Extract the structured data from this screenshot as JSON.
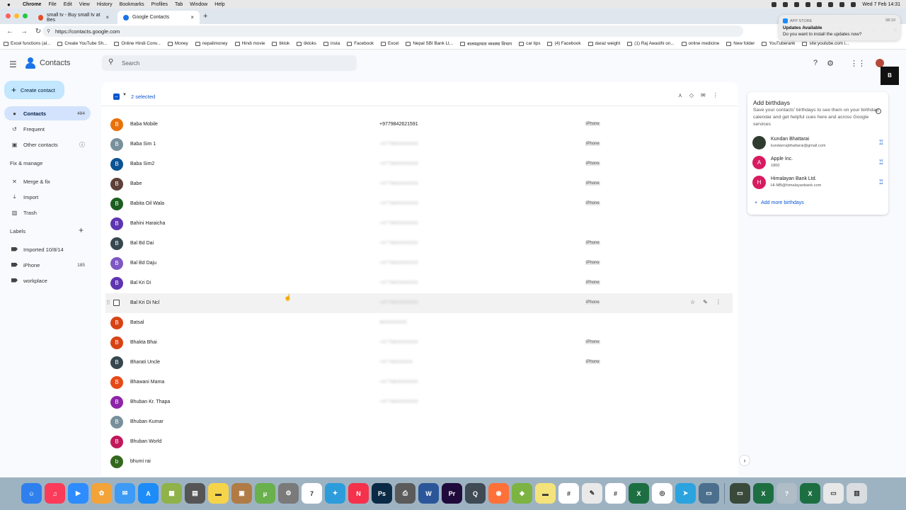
{
  "menubar": {
    "app": "Chrome",
    "items": [
      "File",
      "Edit",
      "View",
      "History",
      "Bookmarks",
      "Profiles",
      "Tab",
      "Window",
      "Help"
    ],
    "clock": "Wed 7 Feb  14:31"
  },
  "tabs": [
    {
      "title": "small tv - Buy small tv at Bes",
      "favicon_color": "#e44d26"
    },
    {
      "title": "Google Contacts",
      "favicon_color": "#1a73e8"
    }
  ],
  "address": {
    "url": "https://contacts.google.com"
  },
  "bookmarks": [
    "Excel functions (al...",
    "Create YouTube Sh...",
    "Online Hindi Conv...",
    "Money",
    "nepalimoney",
    "Hindi movie",
    "tiktok",
    "tiktoks",
    "insta",
    "Facebook",
    "Excel",
    "Nepal SBI Bank Lt...",
    "बालसहायता व्यवस्था विभाग",
    "car tips",
    "(4) Facebook",
    "daraz weight",
    "(1) Raj Awasthi on...",
    "online medicine",
    "New folder",
    "YouTuberank",
    "site:youtube.com i..."
  ],
  "app": {
    "title": "Contacts",
    "search_placeholder": "Search"
  },
  "sidebar": {
    "create_label": "Create contact",
    "items": [
      {
        "label": "Contacts",
        "count": "484",
        "icon": "person-icon"
      },
      {
        "label": "Frequent",
        "count": "",
        "icon": "history-icon"
      },
      {
        "label": "Other contacts",
        "count": "",
        "icon": "download-box-icon"
      }
    ],
    "fix_heading": "Fix & manage",
    "fix_items": [
      {
        "label": "Merge & fix",
        "icon": "tools-icon"
      },
      {
        "label": "Import",
        "icon": "import-icon"
      },
      {
        "label": "Trash",
        "icon": "trash-icon"
      }
    ],
    "labels_heading": "Labels",
    "labels": [
      {
        "label": "Imported 10/8/14",
        "count": ""
      },
      {
        "label": "iPhone",
        "count": "185"
      },
      {
        "label": "workplace",
        "count": ""
      }
    ]
  },
  "toolbar": {
    "selected_text": "2 selected"
  },
  "contacts": [
    {
      "initial": "B",
      "name": "Baba Mobile",
      "phone": "+9779842621591",
      "blurred": false,
      "label": "iPhone",
      "color": "#e8710a"
    },
    {
      "initial": "B",
      "name": "Baba Sim 1",
      "phone": "+9779800000000",
      "blurred": true,
      "label": "iPhone",
      "color": "#78909c"
    },
    {
      "initial": "B",
      "name": "Baba Sim2",
      "phone": "+9779800000000",
      "blurred": true,
      "label": "iPhone",
      "color": "#0b5394"
    },
    {
      "initial": "B",
      "name": "Babe",
      "phone": "+9779800000000",
      "blurred": true,
      "label": "iPhone",
      "color": "#5d4037"
    },
    {
      "initial": "B",
      "name": "Babita Oil Wala",
      "phone": "+9779800000000",
      "blurred": true,
      "label": "iPhone",
      "color": "#1b5e20"
    },
    {
      "initial": "B",
      "name": "Bahini Haraicha",
      "phone": "+9779800000000",
      "blurred": true,
      "label": "",
      "color": "#5e35b1"
    },
    {
      "initial": "B",
      "name": "Bal Bd Dai",
      "phone": "+9779800000000",
      "blurred": true,
      "label": "iPhone",
      "color": "#37474f"
    },
    {
      "initial": "B",
      "name": "Bal Bd Daju",
      "phone": "+9779800000000",
      "blurred": true,
      "label": "iPhone",
      "color": "#7e57c2"
    },
    {
      "initial": "B",
      "name": "Bal Kri Di",
      "phone": "+9779800000000",
      "blurred": true,
      "label": "iPhone",
      "color": "#5e35b1"
    },
    {
      "initial": "",
      "name": "Bal Kri Di Ncl",
      "phone": "+9779800000000",
      "blurred": true,
      "label": "iPhone",
      "color": "",
      "hover": true
    },
    {
      "initial": "B",
      "name": "Batsal",
      "phone": "9800000000",
      "blurred": true,
      "label": "",
      "color": "#d84315"
    },
    {
      "initial": "B",
      "name": "Bhakta Bhai",
      "phone": "+9779800000000",
      "blurred": true,
      "label": "iPhone",
      "color": "#d84315"
    },
    {
      "initial": "B",
      "name": "Bharati Uncle",
      "phone": "+97798000000",
      "blurred": true,
      "label": "iPhone",
      "color": "#37474f"
    },
    {
      "initial": "B",
      "name": "Bhawani Mama",
      "phone": "+9779800000000",
      "blurred": true,
      "label": "",
      "color": "#e64a19"
    },
    {
      "initial": "B",
      "name": "Bhuban Kr. Thapa",
      "phone": "+9779800000000",
      "blurred": true,
      "label": "",
      "color": "#8e24aa"
    },
    {
      "initial": "B",
      "name": "Bhuban Kumar",
      "phone": "",
      "blurred": false,
      "label": "",
      "color": "#78909c"
    },
    {
      "initial": "B",
      "name": "Bhuban World",
      "phone": "",
      "blurred": false,
      "label": "",
      "color": "#c2185b"
    },
    {
      "initial": "b",
      "name": "bhumi rai",
      "phone": "",
      "blurred": false,
      "label": "",
      "color": "#33691e"
    }
  ],
  "birthdays": {
    "title": "Add birthdays",
    "description": "Save your contacts' birthdays to see them on your birthday calendar and get helpful cues here and across Google services",
    "people": [
      {
        "initial": "",
        "name": "Kundan Bhattarai",
        "sub": "kundanrajbhattarai@gmail.com",
        "color": "#2e3b2e"
      },
      {
        "initial": "A",
        "name": "Apple Inc.",
        "sub": "1800",
        "color": "#d81b60"
      },
      {
        "initial": "H",
        "name": "Himalayan Bank Ltd.",
        "sub": "HI-MB@himalayanbank.com",
        "color": "#d81b60"
      }
    ],
    "add_more": "Add more birthdays"
  },
  "badge": "B",
  "notification": {
    "source": "APP STORE",
    "time": "08:10",
    "title": "Updates Available",
    "body": "Do you want to install the updates now?"
  },
  "dock": [
    {
      "icon": "finder-icon",
      "color": "#2f80ed",
      "glyph": "☺"
    },
    {
      "icon": "music-icon",
      "color": "#fa3c5a",
      "glyph": "♫"
    },
    {
      "icon": "zoom-icon",
      "color": "#2d8cff",
      "glyph": "▶"
    },
    {
      "icon": "photos-icon",
      "color": "#f2a33a",
      "glyph": "✿"
    },
    {
      "icon": "mail-icon",
      "color": "#3d9bf5",
      "glyph": "✉"
    },
    {
      "icon": "appstore-icon",
      "color": "#1d8cf8",
      "glyph": "A"
    },
    {
      "icon": "launchpad-icon",
      "color": "#8fb24a",
      "glyph": "▦"
    },
    {
      "icon": "calculator-icon",
      "color": "#555555",
      "glyph": "▤"
    },
    {
      "icon": "notes-icon",
      "color": "#f6d44a",
      "glyph": "▬"
    },
    {
      "icon": "archive-icon",
      "color": "#b07b45",
      "glyph": "▣"
    },
    {
      "icon": "utorrent-icon",
      "color": "#6ab04c",
      "glyph": "μ"
    },
    {
      "icon": "settings-icon",
      "color": "#7a7a7a",
      "glyph": "⚙"
    },
    {
      "icon": "calendar-icon",
      "color": "#ffffff",
      "glyph": "7"
    },
    {
      "icon": "safari-icon",
      "color": "#2d9cdb",
      "glyph": "✦"
    },
    {
      "icon": "news-icon",
      "color": "#f5314b",
      "glyph": "N"
    },
    {
      "icon": "photoshop-icon",
      "color": "#0b2a45",
      "glyph": "Ps"
    },
    {
      "icon": "printer-icon",
      "color": "#5b5b5b",
      "glyph": "⎙"
    },
    {
      "icon": "word-icon",
      "color": "#2b579a",
      "glyph": "W"
    },
    {
      "icon": "premiere-icon",
      "color": "#1f0a3b",
      "glyph": "Pr"
    },
    {
      "icon": "quicktime-icon",
      "color": "#3f4a55",
      "glyph": "Q"
    },
    {
      "icon": "firefox-icon",
      "color": "#ff7139",
      "glyph": "◉"
    },
    {
      "icon": "android-icon",
      "color": "#7cb342",
      "glyph": "◆"
    },
    {
      "icon": "stickies-icon",
      "color": "#f4e37a",
      "glyph": "▬"
    },
    {
      "icon": "slack-icon",
      "color": "#ffffff",
      "glyph": "#"
    },
    {
      "icon": "textedit-icon",
      "color": "#e9e9e9",
      "glyph": "✎"
    },
    {
      "icon": "slack2-icon",
      "color": "#ffffff",
      "glyph": "#"
    },
    {
      "icon": "excel-icon",
      "color": "#1d6f42",
      "glyph": "X"
    },
    {
      "icon": "chrome-icon",
      "color": "#ffffff",
      "glyph": "◎"
    },
    {
      "icon": "telegram-icon",
      "color": "#2aa3df",
      "glyph": "➤"
    },
    {
      "icon": "monitor-icon",
      "color": "#4d6f8e",
      "glyph": "▭"
    },
    {
      "icon": "screen-icon",
      "color": "#3a4a3a",
      "glyph": "▭"
    },
    {
      "icon": "excel-doc-icon",
      "color": "#1d6f42",
      "glyph": "X"
    },
    {
      "icon": "question-icon",
      "color": "#b0bcc6",
      "glyph": "?"
    },
    {
      "icon": "excel-doc2-icon",
      "color": "#1d6f42",
      "glyph": "X"
    },
    {
      "icon": "window-icon",
      "color": "#e8e8e8",
      "glyph": "▭"
    },
    {
      "icon": "trash-dock-icon",
      "color": "#d9dde0",
      "glyph": "▥"
    }
  ]
}
